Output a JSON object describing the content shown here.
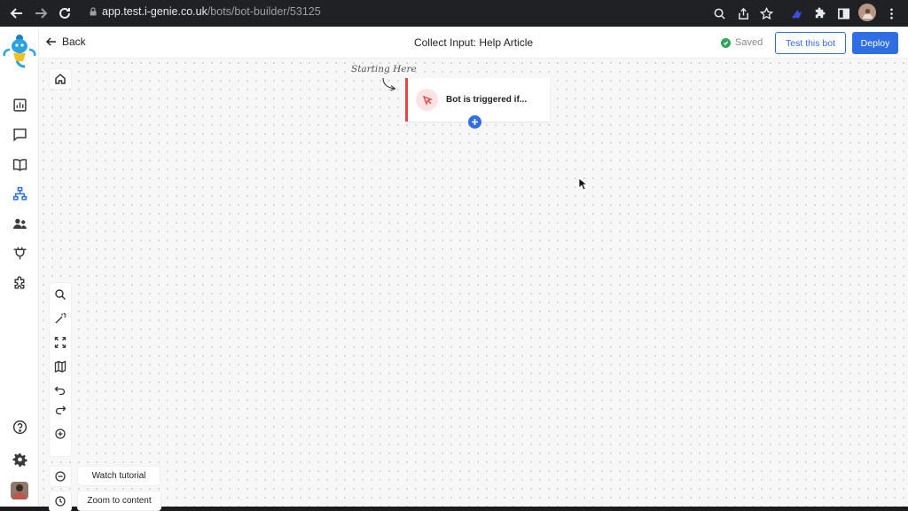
{
  "browser": {
    "url_host": "app.test.i-genie.co.uk",
    "url_path": "/bots/bot-builder/53125",
    "accent_color": "#2f6fe4"
  },
  "header": {
    "back_label": "Back",
    "title": "Collect Input: Help Article",
    "saved_label": "Saved",
    "test_label": "Test this bot",
    "deploy_label": "Deploy"
  },
  "sidebar": {
    "items": [
      {
        "icon": "analytics-icon"
      },
      {
        "icon": "chat-icon"
      },
      {
        "icon": "book-icon"
      },
      {
        "icon": "bot-builder-icon",
        "active": true
      },
      {
        "icon": "users-icon"
      },
      {
        "icon": "integrations-plug-icon"
      },
      {
        "icon": "puzzle-icon"
      }
    ],
    "bottom": [
      {
        "icon": "help-icon"
      },
      {
        "icon": "settings-gear-icon"
      },
      {
        "icon": "user-avatar"
      }
    ]
  },
  "canvas": {
    "annotation": "Starting Here",
    "node_label": "Bot is triggered if...",
    "node_color": "#e04a4a",
    "watch_tutorial_label": "Watch tutorial",
    "zoom_to_content_label": "Zoom to content"
  }
}
